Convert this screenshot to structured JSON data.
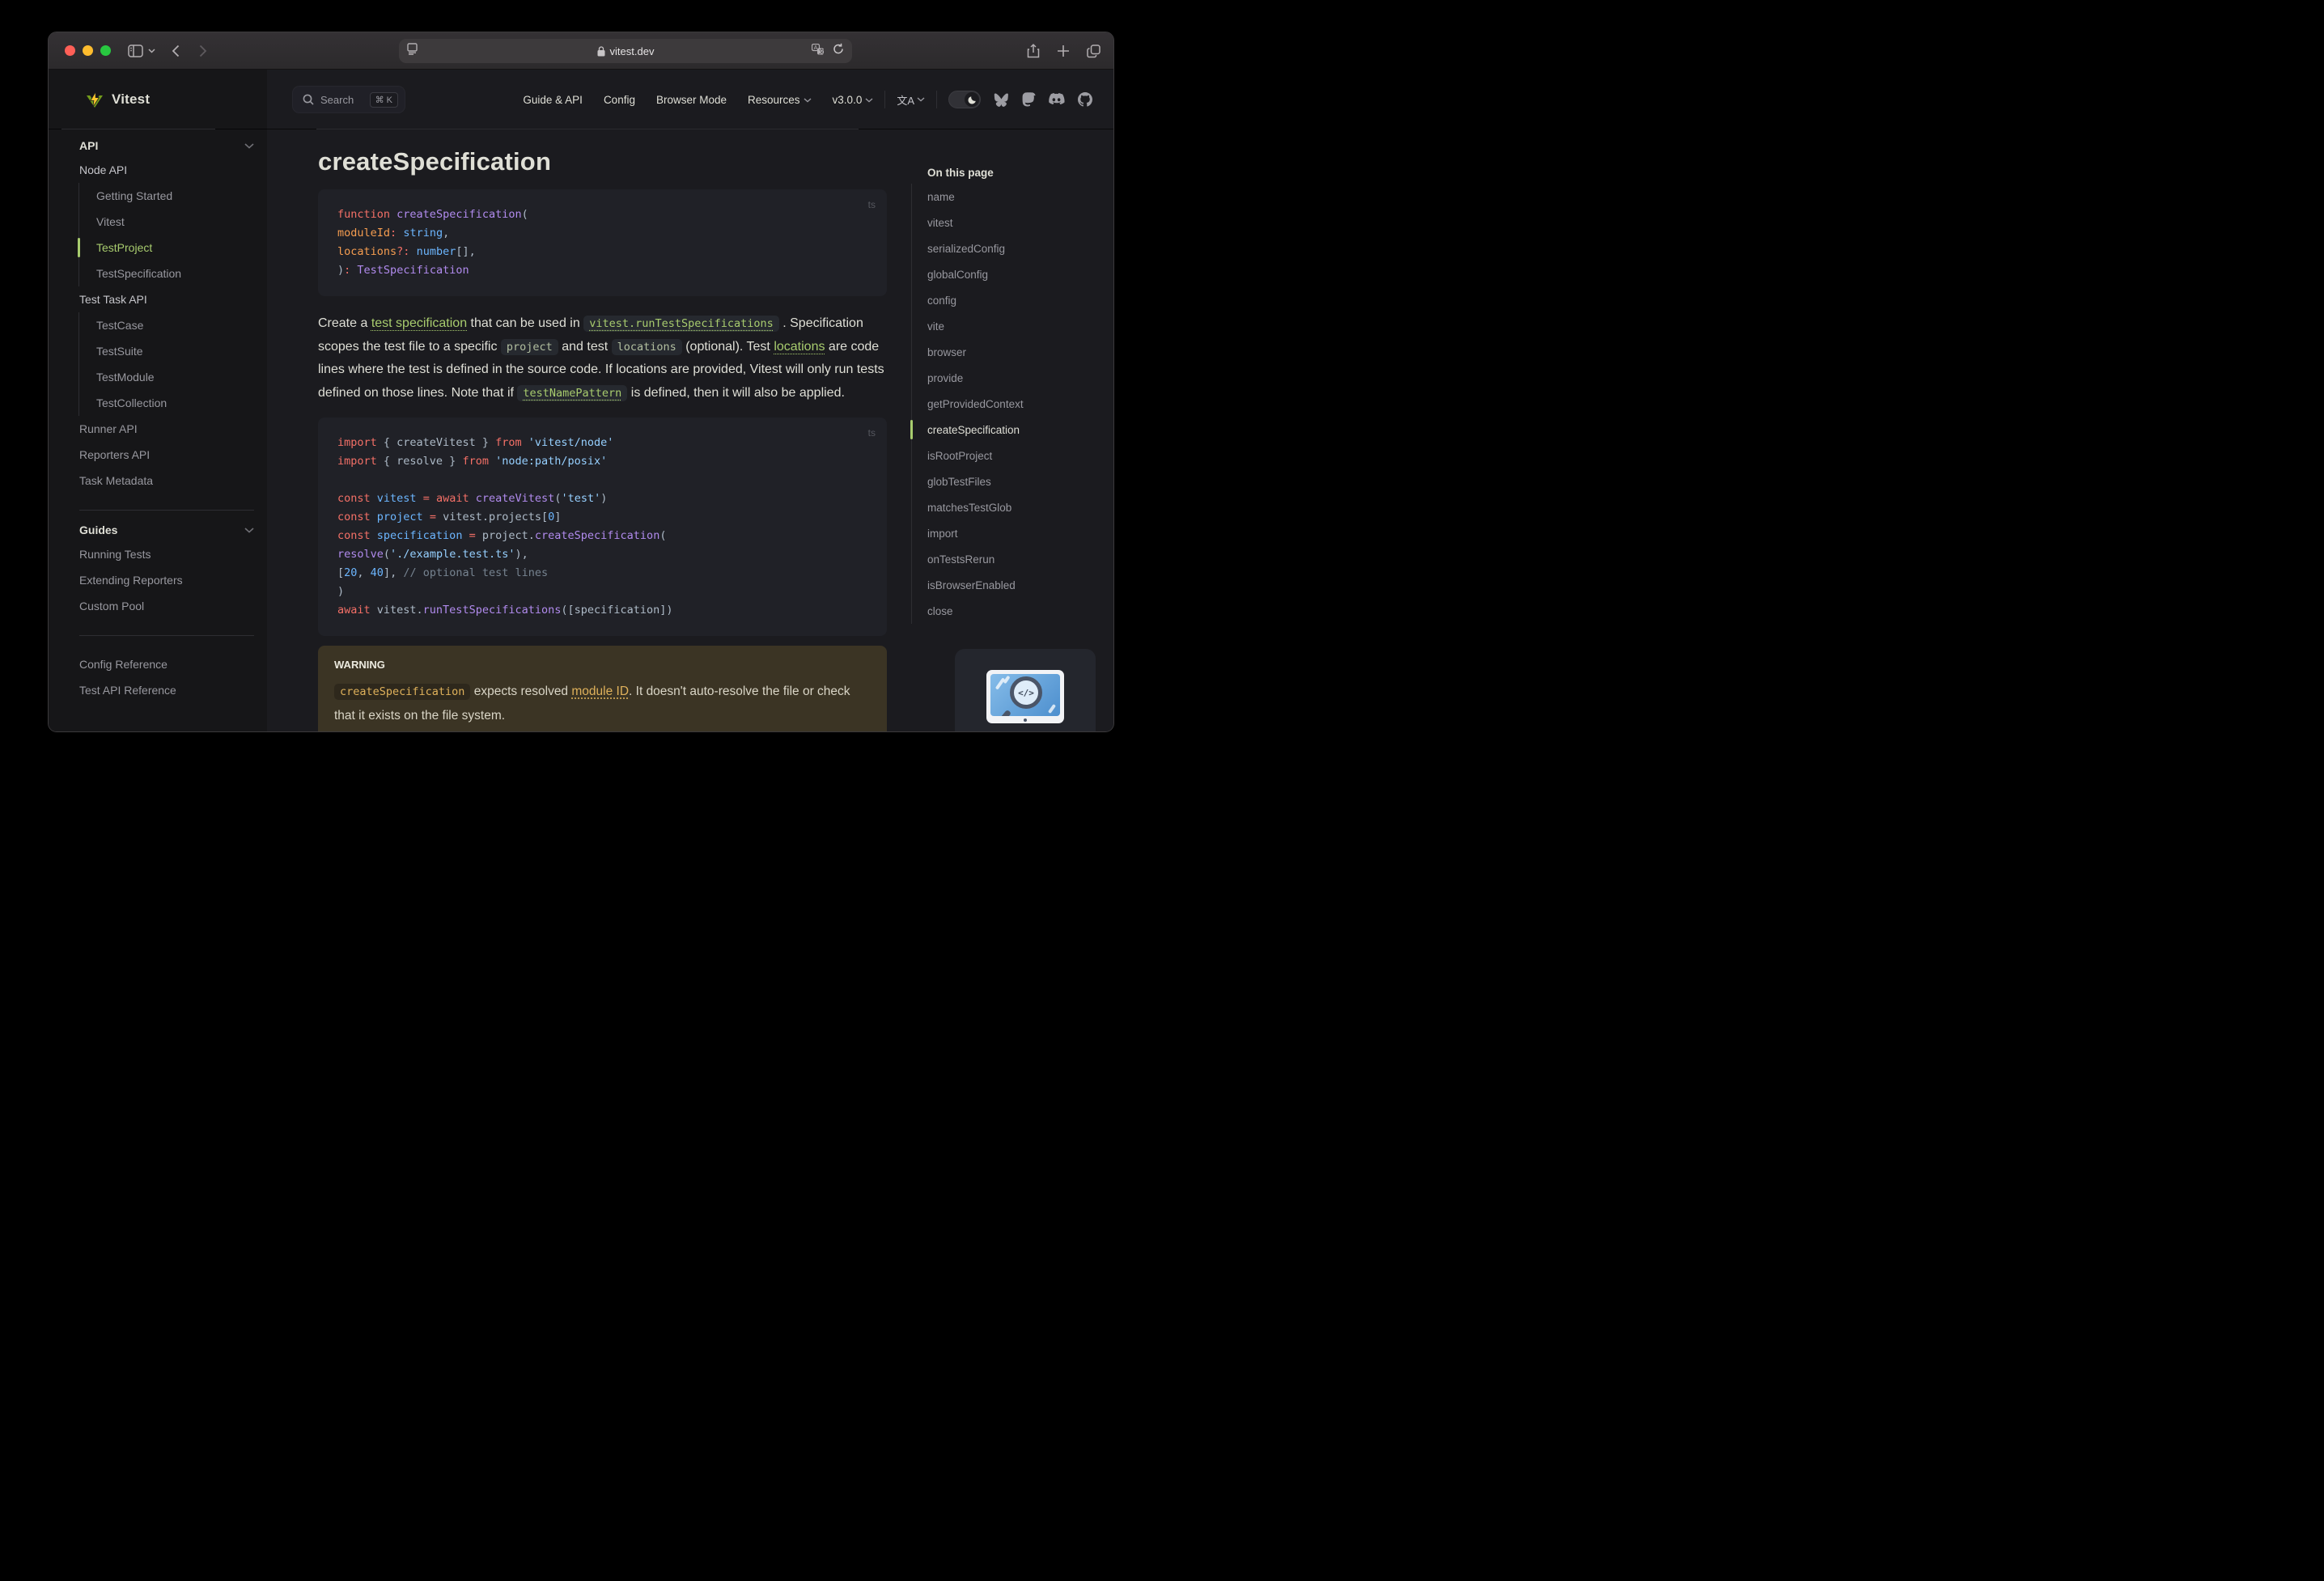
{
  "colors": {
    "accent_green": "#a8cc6e",
    "warning_accent": "#dfb15b",
    "traffic_red": "#ff5f57",
    "traffic_yellow": "#febc2e",
    "traffic_green": "#28c840",
    "code_bg": "#202127",
    "sidebar_bg": "#161618",
    "page_bg": "#1b1b1f"
  },
  "browser": {
    "url": "vitest.dev",
    "lock_icon": "lock",
    "buttons": [
      "sidebar-toggle",
      "back",
      "forward",
      "reader",
      "translate",
      "reload",
      "share",
      "new-tab",
      "tab-overview"
    ]
  },
  "navbar": {
    "logo_text": "Vitest",
    "search": {
      "label": "Search",
      "shortcut": "⌘ K"
    },
    "links": [
      {
        "label": "Guide & API",
        "chevron": false
      },
      {
        "label": "Config",
        "chevron": false
      },
      {
        "label": "Browser Mode",
        "chevron": false
      },
      {
        "label": "Resources",
        "chevron": true
      },
      {
        "label": "v3.0.0",
        "chevron": true
      }
    ],
    "lang_label": "文A",
    "socials": [
      "bluesky",
      "mastodon",
      "discord",
      "github"
    ]
  },
  "sidebar": {
    "items": [
      {
        "label": "API",
        "section": true,
        "chevron": true
      },
      {
        "label": "Node API",
        "subhead": true
      },
      {
        "label": "Getting Started",
        "indent": true
      },
      {
        "label": "Vitest",
        "indent": true
      },
      {
        "label": "TestProject",
        "indent": true,
        "active": true
      },
      {
        "label": "TestSpecification",
        "indent": true
      },
      {
        "label": "Test Task API",
        "subhead": true
      },
      {
        "label": "TestCase",
        "indent": true
      },
      {
        "label": "TestSuite",
        "indent": true
      },
      {
        "label": "TestModule",
        "indent": true
      },
      {
        "label": "TestCollection",
        "indent": true
      },
      {
        "label": "Runner API"
      },
      {
        "label": "Reporters API"
      },
      {
        "label": "Task Metadata"
      },
      {
        "divider": true
      },
      {
        "label": "Guides",
        "section": true,
        "chevron": true
      },
      {
        "label": "Running Tests"
      },
      {
        "label": "Extending Reporters"
      },
      {
        "label": "Custom Pool"
      },
      {
        "divider": true
      },
      {
        "gap": true
      },
      {
        "label": "Config Reference"
      },
      {
        "label": "Test API Reference"
      }
    ]
  },
  "content": {
    "title": "createSpecification",
    "code_blocks": [
      {
        "lang": "ts",
        "lines": [
          [
            {
              "s": "function",
              "c": "kw"
            },
            {
              "s": " ",
              "c": "pl"
            },
            {
              "s": "createSpecification",
              "c": "fn"
            },
            {
              "s": "(",
              "c": "pl"
            }
          ],
          [
            {
              "s": "  ",
              "c": "pl"
            },
            {
              "s": "moduleId",
              "c": "prm"
            },
            {
              "s": ":",
              "c": "kw"
            },
            {
              "s": " ",
              "c": "pl"
            },
            {
              "s": "string",
              "c": "var"
            },
            {
              "s": ",",
              "c": "pl"
            }
          ],
          [
            {
              "s": "  ",
              "c": "pl"
            },
            {
              "s": "locations",
              "c": "prm"
            },
            {
              "s": "?:",
              "c": "kw"
            },
            {
              "s": " ",
              "c": "pl"
            },
            {
              "s": "number",
              "c": "var"
            },
            {
              "s": "[],",
              "c": "pl"
            }
          ],
          [
            {
              "s": ")",
              "c": "pl"
            },
            {
              "s": ":",
              "c": "kw"
            },
            {
              "s": " ",
              "c": "pl"
            },
            {
              "s": "TestSpecification",
              "c": "fn"
            }
          ]
        ]
      },
      {
        "lang": "ts",
        "lines": [
          [
            {
              "s": "import",
              "c": "kw"
            },
            {
              "s": " { createVitest } ",
              "c": "pl"
            },
            {
              "s": "from",
              "c": "kw"
            },
            {
              "s": " ",
              "c": "pl"
            },
            {
              "s": "'vitest/node'",
              "c": "str"
            }
          ],
          [
            {
              "s": "import",
              "c": "kw"
            },
            {
              "s": " { resolve } ",
              "c": "pl"
            },
            {
              "s": "from",
              "c": "kw"
            },
            {
              "s": " ",
              "c": "pl"
            },
            {
              "s": "'node:path/posix'",
              "c": "str"
            }
          ],
          [],
          [
            {
              "s": "const",
              "c": "kw"
            },
            {
              "s": " ",
              "c": "pl"
            },
            {
              "s": "vitest",
              "c": "var"
            },
            {
              "s": " ",
              "c": "pl"
            },
            {
              "s": "=",
              "c": "kw"
            },
            {
              "s": " ",
              "c": "pl"
            },
            {
              "s": "await",
              "c": "kw"
            },
            {
              "s": " ",
              "c": "pl"
            },
            {
              "s": "createVitest",
              "c": "fn"
            },
            {
              "s": "(",
              "c": "pl"
            },
            {
              "s": "'test'",
              "c": "str"
            },
            {
              "s": ")",
              "c": "pl"
            }
          ],
          [
            {
              "s": "const",
              "c": "kw"
            },
            {
              "s": " ",
              "c": "pl"
            },
            {
              "s": "project",
              "c": "var"
            },
            {
              "s": " ",
              "c": "pl"
            },
            {
              "s": "=",
              "c": "kw"
            },
            {
              "s": " vitest.projects[",
              "c": "pl"
            },
            {
              "s": "0",
              "c": "num"
            },
            {
              "s": "]",
              "c": "pl"
            }
          ],
          [
            {
              "s": "const",
              "c": "kw"
            },
            {
              "s": " ",
              "c": "pl"
            },
            {
              "s": "specification",
              "c": "var"
            },
            {
              "s": " ",
              "c": "pl"
            },
            {
              "s": "=",
              "c": "kw"
            },
            {
              "s": " project.",
              "c": "pl"
            },
            {
              "s": "createSpecification",
              "c": "fn"
            },
            {
              "s": "(",
              "c": "pl"
            }
          ],
          [
            {
              "s": "  ",
              "c": "pl"
            },
            {
              "s": "resolve",
              "c": "fn"
            },
            {
              "s": "(",
              "c": "pl"
            },
            {
              "s": "'./example.test.ts'",
              "c": "str"
            },
            {
              "s": "),",
              "c": "pl"
            }
          ],
          [
            {
              "s": "  [",
              "c": "pl"
            },
            {
              "s": "20",
              "c": "num"
            },
            {
              "s": ", ",
              "c": "pl"
            },
            {
              "s": "40",
              "c": "num"
            },
            {
              "s": "], ",
              "c": "pl"
            },
            {
              "s": "// optional test lines",
              "c": "cmt"
            }
          ],
          [
            {
              "s": ")",
              "c": "pl"
            }
          ],
          [
            {
              "s": "await",
              "c": "kw"
            },
            {
              "s": " vitest.",
              "c": "pl"
            },
            {
              "s": "runTestSpecifications",
              "c": "fn"
            },
            {
              "s": "([specification])",
              "c": "pl"
            }
          ]
        ]
      }
    ],
    "paragraph": [
      {
        "t": "text",
        "s": "Create a "
      },
      {
        "t": "link",
        "s": "test specification"
      },
      {
        "t": "text",
        "s": " that can be used in "
      },
      {
        "t": "codelink",
        "s": "vitest.runTestSpecifications"
      },
      {
        "t": "text",
        "s": " . Specification scopes the test file to a specific "
      },
      {
        "t": "code",
        "s": "project"
      },
      {
        "t": "text",
        "s": " and test "
      },
      {
        "t": "code",
        "s": "locations"
      },
      {
        "t": "text",
        "s": " (optional). Test "
      },
      {
        "t": "link",
        "s": "locations"
      },
      {
        "t": "text",
        "s": " are code lines where the test is defined in the source code. If locations are provided, Vitest will only run tests defined on those lines. Note that if "
      },
      {
        "t": "codelink",
        "s": "testNamePattern"
      },
      {
        "t": "text",
        "s": " is defined, then it will also be applied."
      }
    ],
    "warning": {
      "label": "WARNING",
      "line1": [
        {
          "t": "code",
          "s": "createSpecification"
        },
        {
          "t": "text",
          "s": " expects resolved "
        },
        {
          "t": "link",
          "s": "module ID"
        },
        {
          "t": "text",
          "s": ". It doesn't auto-resolve the file or check that it exists on the file system."
        }
      ]
    }
  },
  "aside": {
    "title": "On this page",
    "items": [
      "name",
      "vitest",
      "serializedConfig",
      "globalConfig",
      "config",
      "vite",
      "browser",
      "provide",
      "getProvidedContext",
      "createSpecification",
      "isRootProject",
      "globTestFiles",
      "matchesTestGlob",
      "import",
      "onTestsRerun",
      "isBrowserEnabled",
      "close"
    ],
    "active": "createSpecification"
  }
}
